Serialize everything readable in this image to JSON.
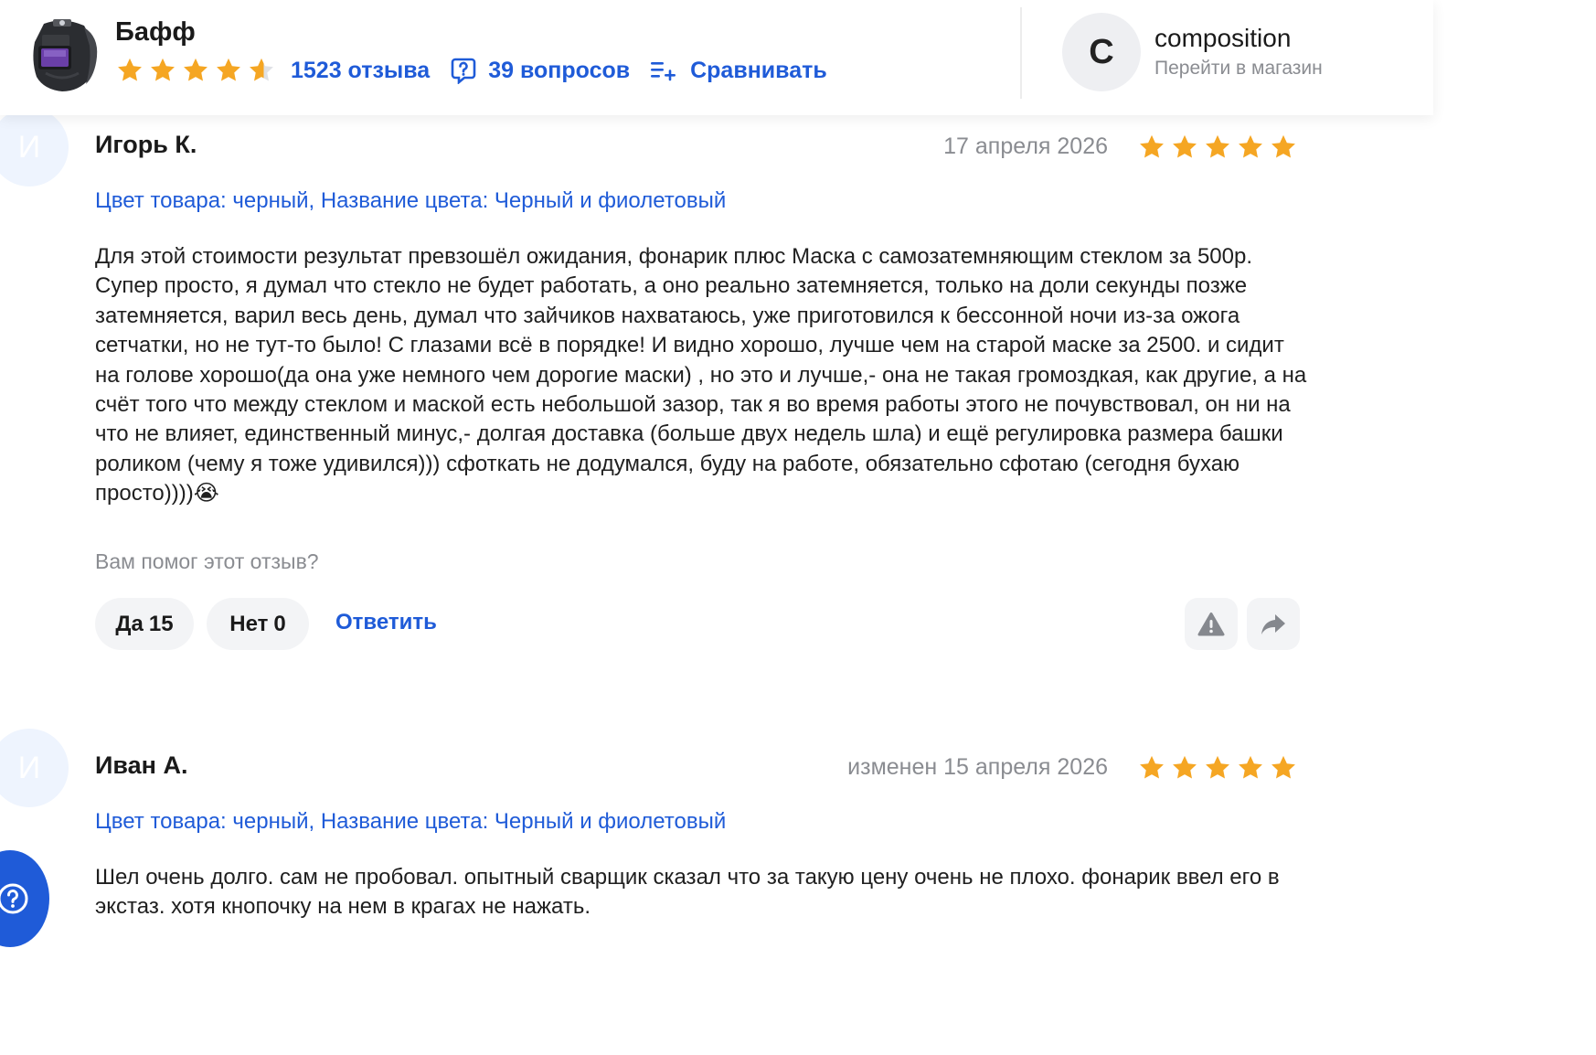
{
  "header": {
    "product_title": "Бафф",
    "rating": 4.6,
    "reviews_link": "1523 отзыва",
    "questions_link": "39 вопросов",
    "compare_link": "Сравнивать",
    "shop": {
      "avatar_letter": "C",
      "name": "composition",
      "subtitle": "Перейти в магазин"
    }
  },
  "colors": {
    "accent": "#1f5bd8",
    "star": "#f5a623",
    "muted": "#8a8c91"
  },
  "reviews": [
    {
      "avatar_letter": "И",
      "author": "Игорь К.",
      "date": "17 апреля 2026",
      "rating": 5,
      "variant": "Цвет товара: черный, Название цвета: Черный и фиолетовый",
      "text": "Для этой стоимости результат превзошёл ожидания, фонарик плюс Маска с самозатемняющим стеклом за 500р. Супер просто, я думал что стекло не будет работать, а оно реально затемняется, только на доли секунды позже затемняется, варил весь день, думал что зайчиков нахватаюсь, уже приготовился к бессонной ночи из-за ожога сетчатки, но не тут-то было! С глазами всё в порядке! И видно хорошо, лучше чем на старой маске за 2500. и сидит на голове хорошо(да она уже немного чем дорогие маски) , но это и лучше,- она не такая громоздкая, как другие, а на счёт того что между стеклом и маской есть небольшой зазор, так я во время работы этого не почувствовал, он ни на что не влияет, единственный минус,- долгая доставка (больше двух недель шла) и ещё регулировка размера башки роликом (чему я тоже удивился))) сфоткать не додумался, буду на работе, обязательно сфотаю (сегодня бухаю просто))))😭",
      "helpful_question": "Вам помог этот отзыв?",
      "yes_label": "Да",
      "yes_count": "15",
      "no_label": "Нет",
      "no_count": "0",
      "reply_label": "Ответить",
      "report_icon": "warning-icon",
      "share_icon": "share-arrow-icon"
    },
    {
      "avatar_letter": "И",
      "author": "Иван А.",
      "date": "изменен 15 апреля 2026",
      "rating": 5,
      "variant": "Цвет товара: черный, Название цвета: Черный и фиолетовый",
      "text": "Шел очень долго. сам не пробовал. опытный сварщик сказал что за такую цену очень не плохо. фонарик ввел его в экстаз. хотя кнопочку на нем в крагах не нажать."
    }
  ],
  "fab": {
    "icon": "help-question-icon"
  }
}
